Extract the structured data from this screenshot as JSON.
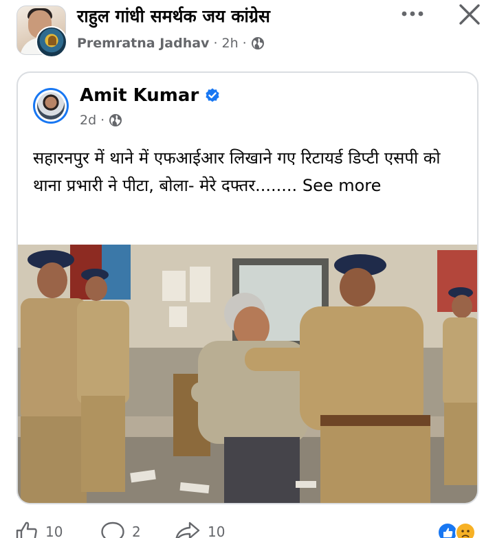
{
  "group": {
    "title": "राहुल गांधी समर्थक जय कांग्रेस",
    "poster": "Premratna Jadhav",
    "time": "2h",
    "separator": "·"
  },
  "shared_post": {
    "author": "Amit Kumar",
    "time": "2d",
    "separator": "·",
    "text": "सहारनपुर में थाने में एफआईआर लिखाने गए रिटायर्ड डिप्टी एसपी को थाना प्रभारी ने पीटा, बोला- मेरे दफ्तर........",
    "see_more": "See more"
  },
  "actions": {
    "likes": "10",
    "comments": "2",
    "shares": "10"
  },
  "icons": [
    "more-icon",
    "close-icon",
    "globe-icon",
    "verified-icon",
    "like-icon",
    "comment-icon",
    "share-icon",
    "reaction-like-icon",
    "reaction-sad-icon"
  ],
  "colors": {
    "text": "#050505",
    "secondary": "#65676b",
    "verified": "#1877f2",
    "border": "#dadde1"
  }
}
